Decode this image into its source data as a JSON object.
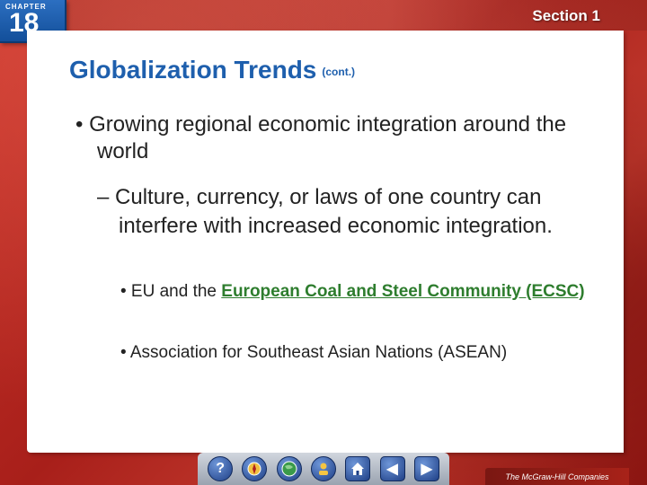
{
  "header": {
    "chapter_label": "CHAPTER",
    "chapter_number": "18",
    "section_label": "Section 1"
  },
  "slide": {
    "title": "Globalization Trends",
    "title_suffix": "(cont.)",
    "bullet1": "• Growing regional economic integration around the world",
    "bullet2": "– Culture, currency, or laws of one country can interfere with increased economic integration.",
    "bullet3_prefix": "• EU and the ",
    "bullet3_link": "European Coal and Steel Community (ECSC)",
    "bullet4": "• Association for Southeast Asian Nations (ASEAN)"
  },
  "nav": {
    "help": "?",
    "prev": "◀",
    "next": "▶"
  },
  "footer": {
    "publisher": "The McGraw-Hill Companies"
  },
  "colors": {
    "title": "#1e5fad",
    "link": "#2e7d2e",
    "background": "#b8251f"
  }
}
